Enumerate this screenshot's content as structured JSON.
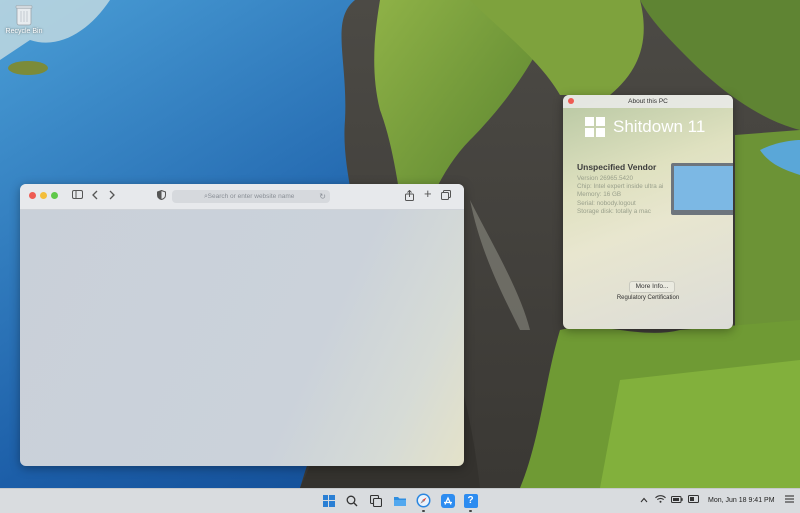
{
  "desktop": {
    "recycle_bin_label": "Recycle Bin"
  },
  "browser": {
    "url_placeholder": "Search or enter website name"
  },
  "about": {
    "window_title": "About this PC",
    "brand_name": "Shitdown 11",
    "vendor": "Unspecified Vendor",
    "specs": [
      "Version 26965.5420",
      "Chip: Intel expert inside ultra ai",
      "Memory: 16 GB",
      "Serial: nobody.logout",
      "Storage disk: totally a mac"
    ],
    "more_info_label": "More Info...",
    "regulatory_label": "Regulatory Certification"
  },
  "taskbar": {
    "clock": "Mon, Jun 18  9:41 PM",
    "help_label": "?"
  },
  "colors": {
    "accent_blue": "#2a7fd4",
    "close_red": "#ee5b53",
    "minimize_yellow": "#f3be3b",
    "maximize_green": "#5fc84a"
  },
  "icons": {
    "start": "windows-logo-icon",
    "search": "search-icon",
    "task_view": "task-view-icon",
    "files": "folder-icon",
    "browser": "compass-icon",
    "store": "app-store-icon",
    "help": "help-icon",
    "wifi": "wifi-icon",
    "battery": "battery-icon",
    "notifications": "menu-icon"
  }
}
